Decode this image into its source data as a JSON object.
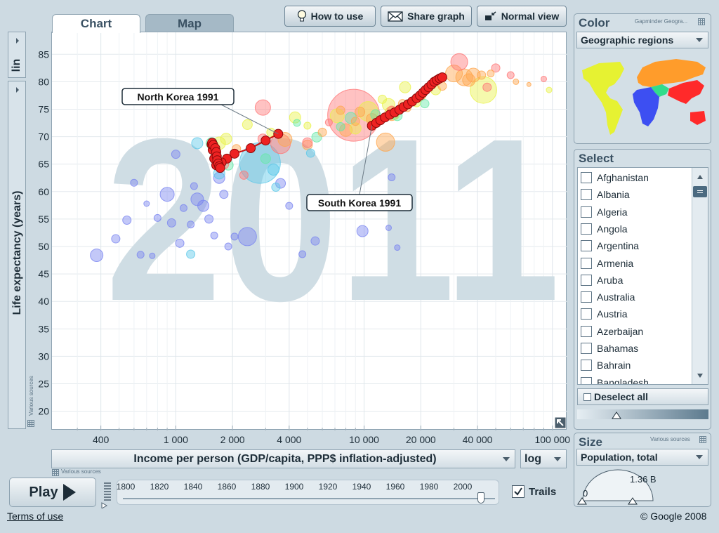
{
  "tabs": [
    {
      "label": "Chart"
    },
    {
      "label": "Map"
    }
  ],
  "toolbar": {
    "how_to_use": "How to use",
    "share_graph": "Share graph",
    "normal_view": "Normal view"
  },
  "y_scale": "lin",
  "x_scale": "log",
  "sources_label": "Various sources",
  "x_indicator": "Income per person (GDP/capita, PPP$ inflation-adjusted)",
  "play_label": "Play",
  "trails_label": "Trails",
  "terms": "Terms of use",
  "copyright": "© Google 2008",
  "color_panel": {
    "title": "Color",
    "provider": "Gapminder Geogra...",
    "selected": "Geographic regions",
    "region_colors": {
      "americas": "#e6f232",
      "europe_central_asia": "#ff9c2b",
      "africa": "#3d4ff2",
      "middle_east": "#32dc8c",
      "east_asia_pacific": "#ff2a2a"
    }
  },
  "select_panel": {
    "title": "Select",
    "countries": [
      "Afghanistan",
      "Albania",
      "Algeria",
      "Angola",
      "Argentina",
      "Armenia",
      "Aruba",
      "Australia",
      "Austria",
      "Azerbaijan",
      "Bahamas",
      "Bahrain",
      "Bangladesh"
    ],
    "deselect_all": "Deselect all"
  },
  "size_panel": {
    "title": "Size",
    "sources": "Various sources",
    "selected": "Population, total",
    "gauge_min": "0",
    "gauge_max": "1.36 B"
  },
  "timeline": {
    "years": [
      "1800",
      "1820",
      "1840",
      "1860",
      "1880",
      "1900",
      "1920",
      "1940",
      "1960",
      "1980",
      "2000"
    ],
    "current_year": 2011
  },
  "chart_data": {
    "type": "scatter",
    "year_watermark": "2011",
    "ylabel": "Life expectancy (years)",
    "xlabel": "Income per person (GDP/capita, PPP$ inflation-adjusted)",
    "x_scale": "log",
    "y_scale": "linear",
    "xlim": [
      220,
      120000
    ],
    "ylim": [
      16.5,
      89
    ],
    "x_ticks": [
      400,
      1000,
      2000,
      4000,
      10000,
      20000,
      40000,
      100000
    ],
    "x_tick_labels": [
      "400",
      "1 000",
      "2 000",
      "4 000",
      "10 000",
      "20 000",
      "40 000",
      "100 000"
    ],
    "y_ticks": [
      20,
      25,
      30,
      35,
      40,
      45,
      50,
      55,
      60,
      65,
      70,
      75,
      80,
      85
    ],
    "grid": true,
    "series": [
      {
        "name": "North Korea",
        "color": "#ee2222",
        "x": [
          3500,
          3000,
          2500,
          2050,
          1870,
          1750,
          1680,
          1640,
          1600,
          1570,
          1550,
          1560,
          1580,
          1620,
          1640,
          1650,
          1660,
          1680,
          1700,
          1720
        ],
        "y": [
          70.5,
          69.3,
          67.9,
          66.9,
          66.0,
          65.3,
          65.0,
          64.8,
          66.0,
          67.6,
          68.6,
          68.9,
          68.5,
          67.9,
          67.2,
          66.4,
          65.7,
          65.1,
          64.6,
          64.3
        ]
      },
      {
        "name": "South Korea",
        "color": "#ee2222",
        "x": [
          11000,
          11600,
          12200,
          12900,
          13700,
          14500,
          15400,
          16200,
          17100,
          18000,
          19000,
          19800,
          20500,
          21200,
          22000,
          22800,
          23600,
          24400,
          25200,
          26000
        ],
        "y": [
          72.0,
          72.5,
          73.0,
          73.5,
          74.0,
          74.4,
          74.9,
          75.4,
          75.9,
          76.4,
          77.0,
          77.5,
          78.0,
          78.5,
          79.0,
          79.5,
          80.0,
          80.3,
          80.6,
          80.8
        ]
      }
    ],
    "labels": [
      {
        "text": "North Korea 1991",
        "x": 3500,
        "y": 70.5
      },
      {
        "text": "South Korea 1991",
        "x": 11000,
        "y": 72.0
      }
    ],
    "bubbles": [
      {
        "x": 1700,
        "y": 68.8,
        "r": 9,
        "region": "americas"
      },
      {
        "x": 1850,
        "y": 69.6,
        "r": 8,
        "region": "americas"
      },
      {
        "x": 2400,
        "y": 72.2,
        "r": 7,
        "region": "americas"
      },
      {
        "x": 4300,
        "y": 73.5,
        "r": 8,
        "region": "americas"
      },
      {
        "x": 7200,
        "y": 73.8,
        "r": 10,
        "region": "americas"
      },
      {
        "x": 10500,
        "y": 74.6,
        "r": 14,
        "region": "americas"
      },
      {
        "x": 13500,
        "y": 75.8,
        "r": 9,
        "region": "americas"
      },
      {
        "x": 16500,
        "y": 79.0,
        "r": 8,
        "region": "americas"
      },
      {
        "x": 24000,
        "y": 78.5,
        "r": 7,
        "region": "americas"
      },
      {
        "x": 43000,
        "y": 78.5,
        "r": 19,
        "region": "americas"
      },
      {
        "x": 9000,
        "y": 71.5,
        "r": 8,
        "region": "americas"
      },
      {
        "x": 3200,
        "y": 70.8,
        "r": 6,
        "region": "americas"
      },
      {
        "x": 19000,
        "y": 76.2,
        "r": 6,
        "region": "americas"
      },
      {
        "x": 14500,
        "y": 74.0,
        "r": 7,
        "region": "americas"
      },
      {
        "x": 5000,
        "y": 72.0,
        "r": 5,
        "region": "americas"
      },
      {
        "x": 12500,
        "y": 76.8,
        "r": 6,
        "region": "americas"
      },
      {
        "x": 30000,
        "y": 81.5,
        "r": 12,
        "region": "europe_central_asia"
      },
      {
        "x": 34000,
        "y": 80.8,
        "r": 12,
        "region": "europe_central_asia"
      },
      {
        "x": 38000,
        "y": 81.2,
        "r": 10,
        "region": "europe_central_asia"
      },
      {
        "x": 36000,
        "y": 80.3,
        "r": 9,
        "region": "europe_central_asia"
      },
      {
        "x": 42000,
        "y": 81.2,
        "r": 6,
        "region": "europe_central_asia"
      },
      {
        "x": 47000,
        "y": 81.5,
        "r": 5,
        "region": "europe_central_asia"
      },
      {
        "x": 26000,
        "y": 79.2,
        "r": 6,
        "region": "europe_central_asia"
      },
      {
        "x": 20000,
        "y": 77.5,
        "r": 7,
        "region": "europe_central_asia"
      },
      {
        "x": 16000,
        "y": 76.0,
        "r": 6,
        "region": "europe_central_asia"
      },
      {
        "x": 14000,
        "y": 74.2,
        "r": 10,
        "region": "europe_central_asia"
      },
      {
        "x": 11000,
        "y": 73.2,
        "r": 8,
        "region": "europe_central_asia"
      },
      {
        "x": 13000,
        "y": 69.0,
        "r": 13,
        "region": "europe_central_asia"
      },
      {
        "x": 9500,
        "y": 74.5,
        "r": 7,
        "region": "europe_central_asia"
      },
      {
        "x": 7500,
        "y": 74.8,
        "r": 6,
        "region": "europe_central_asia"
      },
      {
        "x": 5000,
        "y": 68.5,
        "r": 7,
        "region": "europe_central_asia"
      },
      {
        "x": 3800,
        "y": 69.5,
        "r": 10,
        "region": "europe_central_asia"
      },
      {
        "x": 2100,
        "y": 67.8,
        "r": 6,
        "region": "europe_central_asia"
      },
      {
        "x": 1600,
        "y": 66.0,
        "r": 6,
        "region": "europe_central_asia"
      },
      {
        "x": 9000,
        "y": 72.8,
        "r": 6,
        "region": "europe_central_asia"
      },
      {
        "x": 17000,
        "y": 75.2,
        "r": 5,
        "region": "europe_central_asia"
      },
      {
        "x": 6000,
        "y": 70.8,
        "r": 6,
        "region": "europe_central_asia"
      },
      {
        "x": 8000,
        "y": 71.2,
        "r": 9,
        "region": "europe_central_asia"
      },
      {
        "x": 380,
        "y": 48.4,
        "r": 9,
        "region": "africa"
      },
      {
        "x": 480,
        "y": 51.4,
        "r": 6,
        "region": "africa"
      },
      {
        "x": 550,
        "y": 54.8,
        "r": 6,
        "region": "africa"
      },
      {
        "x": 600,
        "y": 61.6,
        "r": 5,
        "region": "africa"
      },
      {
        "x": 650,
        "y": 48.5,
        "r": 5,
        "region": "africa"
      },
      {
        "x": 750,
        "y": 48.3,
        "r": 4,
        "region": "africa"
      },
      {
        "x": 800,
        "y": 55.2,
        "r": 5,
        "region": "africa"
      },
      {
        "x": 900,
        "y": 59.5,
        "r": 10,
        "region": "africa"
      },
      {
        "x": 950,
        "y": 54.3,
        "r": 6,
        "region": "africa"
      },
      {
        "x": 1000,
        "y": 66.8,
        "r": 6,
        "region": "africa"
      },
      {
        "x": 1050,
        "y": 50.6,
        "r": 6,
        "region": "africa"
      },
      {
        "x": 1100,
        "y": 57.0,
        "r": 5,
        "region": "africa"
      },
      {
        "x": 1200,
        "y": 54.0,
        "r": 5,
        "region": "africa"
      },
      {
        "x": 1300,
        "y": 58.6,
        "r": 9,
        "region": "africa"
      },
      {
        "x": 1400,
        "y": 57.4,
        "r": 8,
        "region": "africa"
      },
      {
        "x": 1500,
        "y": 55.0,
        "r": 6,
        "region": "africa"
      },
      {
        "x": 1600,
        "y": 52.0,
        "r": 5,
        "region": "africa"
      },
      {
        "x": 1700,
        "y": 62.5,
        "r": 8,
        "region": "africa"
      },
      {
        "x": 1800,
        "y": 59.5,
        "r": 6,
        "region": "africa"
      },
      {
        "x": 1900,
        "y": 50.0,
        "r": 5,
        "region": "africa"
      },
      {
        "x": 2050,
        "y": 51.8,
        "r": 5,
        "region": "africa"
      },
      {
        "x": 2400,
        "y": 51.8,
        "r": 13,
        "region": "africa"
      },
      {
        "x": 3600,
        "y": 61.5,
        "r": 7,
        "region": "africa"
      },
      {
        "x": 4000,
        "y": 57.4,
        "r": 5,
        "region": "africa"
      },
      {
        "x": 4700,
        "y": 48.6,
        "r": 5,
        "region": "africa"
      },
      {
        "x": 5500,
        "y": 51.0,
        "r": 6,
        "region": "africa"
      },
      {
        "x": 9800,
        "y": 52.8,
        "r": 8,
        "region": "africa"
      },
      {
        "x": 14000,
        "y": 62.6,
        "r": 5,
        "region": "africa"
      },
      {
        "x": 13500,
        "y": 53.4,
        "r": 4,
        "region": "africa"
      },
      {
        "x": 15000,
        "y": 49.8,
        "r": 4,
        "region": "africa"
      },
      {
        "x": 1250,
        "y": 61.0,
        "r": 5,
        "region": "africa"
      },
      {
        "x": 700,
        "y": 57.8,
        "r": 4,
        "region": "africa"
      },
      {
        "x": 1550,
        "y": 68.8,
        "r": 8,
        "region": "middle_east"
      },
      {
        "x": 3000,
        "y": 66.0,
        "r": 7,
        "region": "middle_east"
      },
      {
        "x": 5600,
        "y": 69.9,
        "r": 7,
        "region": "middle_east"
      },
      {
        "x": 7500,
        "y": 71.8,
        "r": 6,
        "region": "middle_east"
      },
      {
        "x": 8500,
        "y": 73.4,
        "r": 8,
        "region": "middle_east"
      },
      {
        "x": 11500,
        "y": 74.0,
        "r": 7,
        "region": "middle_east"
      },
      {
        "x": 15000,
        "y": 73.8,
        "r": 7,
        "region": "middle_east"
      },
      {
        "x": 1900,
        "y": 64.8,
        "r": 7,
        "region": "middle_east"
      },
      {
        "x": 21000,
        "y": 76.0,
        "r": 6,
        "region": "middle_east"
      },
      {
        "x": 4400,
        "y": 72.5,
        "r": 5,
        "region": "middle_east"
      },
      {
        "x": 2800,
        "y": 65.2,
        "r": 29,
        "region": "south_asia"
      },
      {
        "x": 3300,
        "y": 64.0,
        "r": 8,
        "region": "south_asia"
      },
      {
        "x": 1300,
        "y": 68.8,
        "r": 8,
        "region": "south_asia"
      },
      {
        "x": 1700,
        "y": 63.3,
        "r": 8,
        "region": "south_asia"
      },
      {
        "x": 3400,
        "y": 60.8,
        "r": 6,
        "region": "south_asia"
      },
      {
        "x": 1200,
        "y": 48.6,
        "r": 6,
        "region": "south_asia"
      },
      {
        "x": 5200,
        "y": 67.0,
        "r": 6,
        "region": "south_asia"
      },
      {
        "x": 8800,
        "y": 73.9,
        "r": 37,
        "region": "east_asia_pacific"
      },
      {
        "x": 2900,
        "y": 75.3,
        "r": 11,
        "region": "east_asia_pacific"
      },
      {
        "x": 32000,
        "y": 83.6,
        "r": 12,
        "region": "east_asia_pacific"
      },
      {
        "x": 3600,
        "y": 68.7,
        "r": 14,
        "region": "east_asia_pacific"
      },
      {
        "x": 1800,
        "y": 65.0,
        "r": 7,
        "region": "east_asia_pacific"
      },
      {
        "x": 2300,
        "y": 63.0,
        "r": 6,
        "region": "east_asia_pacific"
      },
      {
        "x": 5000,
        "y": 68.9,
        "r": 7,
        "region": "east_asia_pacific"
      },
      {
        "x": 50000,
        "y": 82.5,
        "r": 6,
        "region": "east_asia_pacific"
      },
      {
        "x": 60000,
        "y": 81.2,
        "r": 5,
        "region": "east_asia_pacific"
      },
      {
        "x": 1600,
        "y": 68.2,
        "r": 6,
        "region": "east_asia_pacific"
      },
      {
        "x": 2900,
        "y": 69.6,
        "r": 7,
        "region": "east_asia_pacific"
      },
      {
        "x": 14000,
        "y": 74.8,
        "r": 6,
        "region": "east_asia_pacific"
      },
      {
        "x": 45000,
        "y": 79.0,
        "r": 6,
        "region": "east_asia_pacific"
      },
      {
        "x": 6500,
        "y": 72.6,
        "r": 5,
        "region": "east_asia_pacific"
      },
      {
        "x": 90000,
        "y": 80.5,
        "r": 4,
        "region": "east_asia_pacific"
      },
      {
        "x": 75000,
        "y": 79.5,
        "r": 3,
        "region": "europe_central_asia"
      },
      {
        "x": 96000,
        "y": 78.5,
        "r": 4,
        "region": "americas"
      },
      {
        "x": 64000,
        "y": 80.0,
        "r": 4,
        "region": "europe_central_asia"
      }
    ]
  }
}
